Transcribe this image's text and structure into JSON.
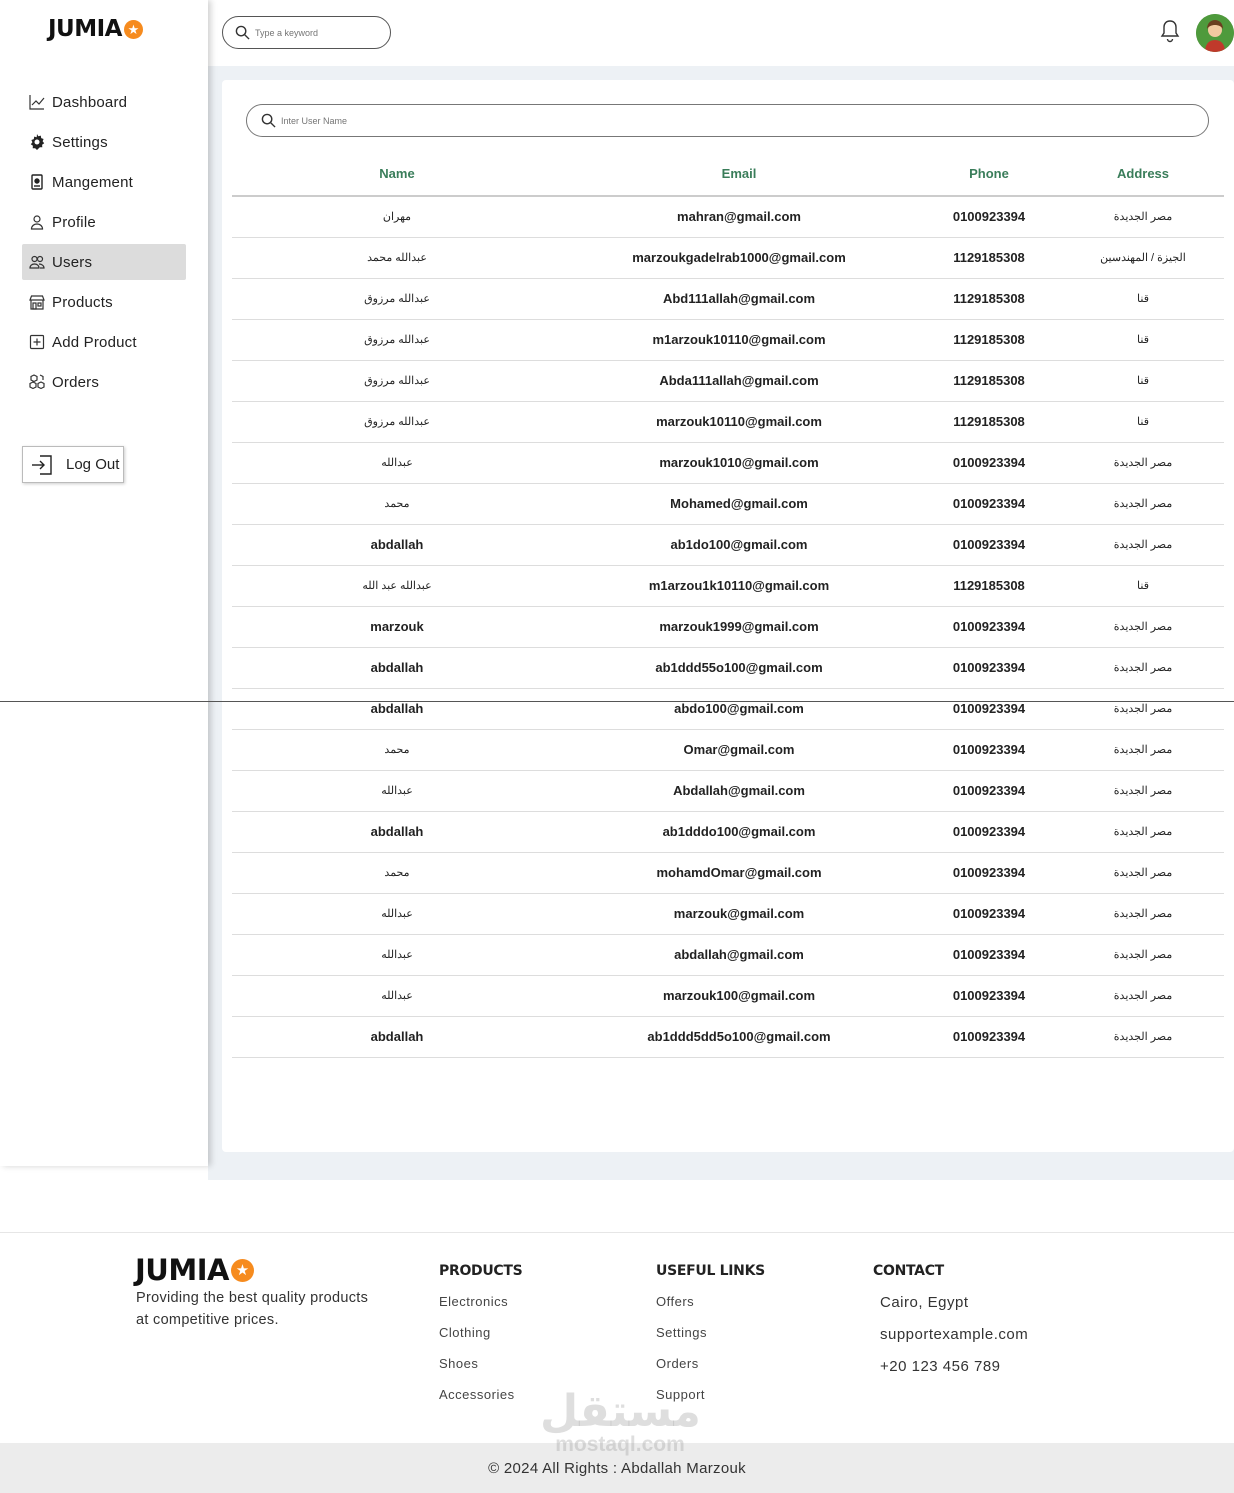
{
  "brand": {
    "name": "JUMIA",
    "accent": "#f68b1e"
  },
  "topbar": {
    "search_placeholder": "Type a keyword"
  },
  "sidebar": {
    "items": [
      {
        "label": "Dashboard",
        "icon": "chart-line-icon"
      },
      {
        "label": "Settings",
        "icon": "gear-icon"
      },
      {
        "label": "Mangement",
        "icon": "id-card-icon"
      },
      {
        "label": "Profile",
        "icon": "user-icon"
      },
      {
        "label": "Users",
        "icon": "users-icon",
        "active": true
      },
      {
        "label": "Products",
        "icon": "store-icon"
      },
      {
        "label": "Add Product",
        "icon": "plus-square-icon"
      },
      {
        "label": "Orders",
        "icon": "boxes-icon"
      }
    ],
    "logout_label": "Log Out"
  },
  "users": {
    "search_placeholder": "Inter User Name",
    "columns": [
      "Name",
      "Email",
      "Phone",
      "Address"
    ],
    "rows": [
      [
        "مهران",
        "mahran@gmail.com",
        "0100923394",
        "مصر الجديدة"
      ],
      [
        "عبدالله محمد",
        "marzoukgadelrab1000@gmail.com",
        "1129185308",
        "الجيزة / المهندسين"
      ],
      [
        "عبدالله مرزوق",
        "Abd111allah@gmail.com",
        "1129185308",
        "قنا"
      ],
      [
        "عبدالله مرزوق",
        "m1arzouk10110@gmail.com",
        "1129185308",
        "قنا"
      ],
      [
        "عبدالله مرزوق",
        "Abda111allah@gmail.com",
        "1129185308",
        "قنا"
      ],
      [
        "عبدالله مرزوق",
        "marzouk10110@gmail.com",
        "1129185308",
        "قنا"
      ],
      [
        "عبدالله",
        "marzouk1010@gmail.com",
        "0100923394",
        "مصر الجديدة"
      ],
      [
        "محمد",
        "Mohamed@gmail.com",
        "0100923394",
        "مصر الجديدة"
      ],
      [
        "abdallah",
        "ab1do100@gmail.com",
        "0100923394",
        "مصر الجديدة"
      ],
      [
        "عبدالله عبد الله",
        "m1arzou1k10110@gmail.com",
        "1129185308",
        "قنا"
      ],
      [
        "marzouk",
        "marzouk1999@gmail.com",
        "0100923394",
        "مصر الجديدة"
      ],
      [
        "abdallah",
        "ab1ddd55o100@gmail.com",
        "0100923394",
        "مصر الجديدة"
      ],
      [
        "abdallah",
        "abdo100@gmail.com",
        "0100923394",
        "مصر الجديدة"
      ],
      [
        "محمد",
        "Omar@gmail.com",
        "0100923394",
        "مصر الجديدة"
      ],
      [
        "عبدالله",
        "Abdallah@gmail.com",
        "0100923394",
        "مصر الجديدة"
      ],
      [
        "abdallah",
        "ab1dddo100@gmail.com",
        "0100923394",
        "مصر الجديدة"
      ],
      [
        "محمد",
        "mohamdOmar@gmail.com",
        "0100923394",
        "مصر الجديدة"
      ],
      [
        "عبدالله",
        "marzouk@gmail.com",
        "0100923394",
        "مصر الجديدة"
      ],
      [
        "عبدالله",
        "abdallah@gmail.com",
        "0100923394",
        "مصر الجديدة"
      ],
      [
        "عبدالله",
        "marzouk100@gmail.com",
        "0100923394",
        "مصر الجديدة"
      ],
      [
        "abdallah",
        "ab1ddd5dd5o100@gmail.com",
        "0100923394",
        "مصر الجديدة"
      ]
    ]
  },
  "footer": {
    "tagline": "Providing the best quality products at competitive prices.",
    "products": {
      "title": "PRODUCTS",
      "links": [
        "Electronics",
        "Clothing",
        "Shoes",
        "Accessories"
      ]
    },
    "useful_links": {
      "title": "USEFUL LINKS",
      "links": [
        "Offers",
        "Settings",
        "Orders",
        "Support"
      ]
    },
    "contact": {
      "title": "CONTACT",
      "lines": [
        "Cairo, Egypt",
        "supportexample.com",
        "+20 123 456 789"
      ]
    },
    "copyright": "© 2024 All Rights : Abdallah Marzouk",
    "watermark_ar": "مستقل",
    "watermark_en": "mostaql.com"
  }
}
